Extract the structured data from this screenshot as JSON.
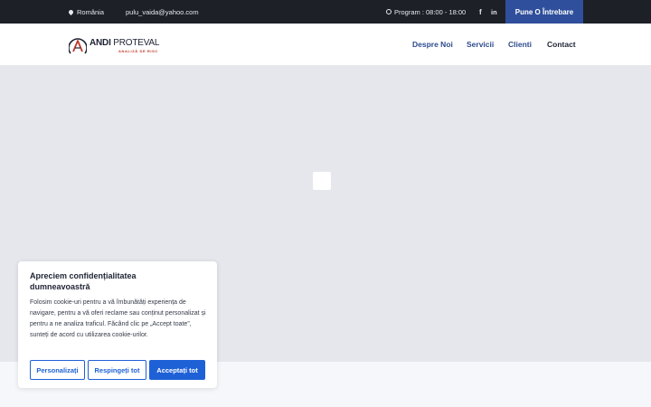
{
  "topbar": {
    "location": "România",
    "email": "pulu_vaida@yahoo.com",
    "schedule": "Program : 08:00 - 18:00",
    "facebook_glyph": "f",
    "linkedin_glyph": "in",
    "cta_label": "Pune O Întrebare",
    "icons": [
      "map-pin-icon",
      "clock-icon",
      "facebook-icon",
      "linkedin-icon"
    ]
  },
  "header": {
    "logo_bold": "ANDI",
    "logo_light": "PROTEVAL",
    "logo_tagline": "ANALIZĂ DE RISC",
    "nav": [
      "Despre Noi",
      "Servicii",
      "Clienti",
      "Contact"
    ]
  },
  "cookie": {
    "title": "Apreciem confidențialitatea dumneavoastră",
    "text": "Folosim cookie-uri pentru a vă îmbunătăți experiența de navigare, pentru a vă oferi reclame sau conținut personalizat și pentru a ne analiza traficul. Făcând clic pe „Accept toate”, sunteți de acord cu utilizarea cookie-urilor.",
    "customize_label": "Personalizați",
    "reject_label": "Respingeți tot",
    "accept_label": "Acceptați tot"
  },
  "colors": {
    "topbar_bg": "#1e2028",
    "cta_bg": "#2f4f9c",
    "nav_active": "#2d4b8e",
    "button_primary": "#1e61d6"
  }
}
